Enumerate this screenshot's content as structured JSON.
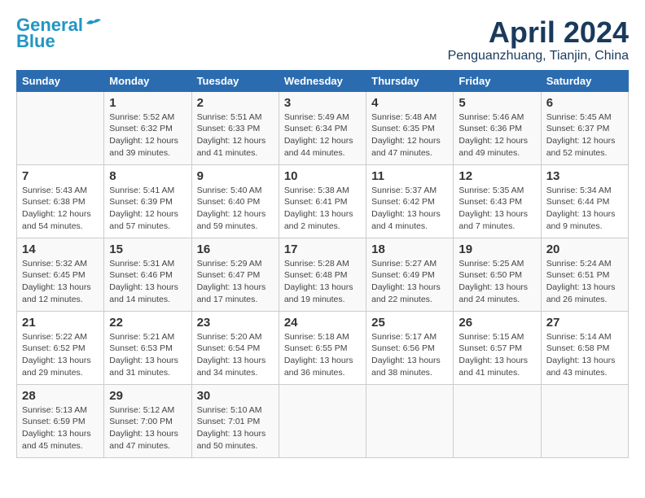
{
  "logo": {
    "line1": "General",
    "line2": "Blue"
  },
  "title": "April 2024",
  "subtitle": "Penguanzhuang, Tianjin, China",
  "weekdays": [
    "Sunday",
    "Monday",
    "Tuesday",
    "Wednesday",
    "Thursday",
    "Friday",
    "Saturday"
  ],
  "weeks": [
    [
      {
        "num": "",
        "info": ""
      },
      {
        "num": "1",
        "info": "Sunrise: 5:52 AM\nSunset: 6:32 PM\nDaylight: 12 hours\nand 39 minutes."
      },
      {
        "num": "2",
        "info": "Sunrise: 5:51 AM\nSunset: 6:33 PM\nDaylight: 12 hours\nand 41 minutes."
      },
      {
        "num": "3",
        "info": "Sunrise: 5:49 AM\nSunset: 6:34 PM\nDaylight: 12 hours\nand 44 minutes."
      },
      {
        "num": "4",
        "info": "Sunrise: 5:48 AM\nSunset: 6:35 PM\nDaylight: 12 hours\nand 47 minutes."
      },
      {
        "num": "5",
        "info": "Sunrise: 5:46 AM\nSunset: 6:36 PM\nDaylight: 12 hours\nand 49 minutes."
      },
      {
        "num": "6",
        "info": "Sunrise: 5:45 AM\nSunset: 6:37 PM\nDaylight: 12 hours\nand 52 minutes."
      }
    ],
    [
      {
        "num": "7",
        "info": "Sunrise: 5:43 AM\nSunset: 6:38 PM\nDaylight: 12 hours\nand 54 minutes."
      },
      {
        "num": "8",
        "info": "Sunrise: 5:41 AM\nSunset: 6:39 PM\nDaylight: 12 hours\nand 57 minutes."
      },
      {
        "num": "9",
        "info": "Sunrise: 5:40 AM\nSunset: 6:40 PM\nDaylight: 12 hours\nand 59 minutes."
      },
      {
        "num": "10",
        "info": "Sunrise: 5:38 AM\nSunset: 6:41 PM\nDaylight: 13 hours\nand 2 minutes."
      },
      {
        "num": "11",
        "info": "Sunrise: 5:37 AM\nSunset: 6:42 PM\nDaylight: 13 hours\nand 4 minutes."
      },
      {
        "num": "12",
        "info": "Sunrise: 5:35 AM\nSunset: 6:43 PM\nDaylight: 13 hours\nand 7 minutes."
      },
      {
        "num": "13",
        "info": "Sunrise: 5:34 AM\nSunset: 6:44 PM\nDaylight: 13 hours\nand 9 minutes."
      }
    ],
    [
      {
        "num": "14",
        "info": "Sunrise: 5:32 AM\nSunset: 6:45 PM\nDaylight: 13 hours\nand 12 minutes."
      },
      {
        "num": "15",
        "info": "Sunrise: 5:31 AM\nSunset: 6:46 PM\nDaylight: 13 hours\nand 14 minutes."
      },
      {
        "num": "16",
        "info": "Sunrise: 5:29 AM\nSunset: 6:47 PM\nDaylight: 13 hours\nand 17 minutes."
      },
      {
        "num": "17",
        "info": "Sunrise: 5:28 AM\nSunset: 6:48 PM\nDaylight: 13 hours\nand 19 minutes."
      },
      {
        "num": "18",
        "info": "Sunrise: 5:27 AM\nSunset: 6:49 PM\nDaylight: 13 hours\nand 22 minutes."
      },
      {
        "num": "19",
        "info": "Sunrise: 5:25 AM\nSunset: 6:50 PM\nDaylight: 13 hours\nand 24 minutes."
      },
      {
        "num": "20",
        "info": "Sunrise: 5:24 AM\nSunset: 6:51 PM\nDaylight: 13 hours\nand 26 minutes."
      }
    ],
    [
      {
        "num": "21",
        "info": "Sunrise: 5:22 AM\nSunset: 6:52 PM\nDaylight: 13 hours\nand 29 minutes."
      },
      {
        "num": "22",
        "info": "Sunrise: 5:21 AM\nSunset: 6:53 PM\nDaylight: 13 hours\nand 31 minutes."
      },
      {
        "num": "23",
        "info": "Sunrise: 5:20 AM\nSunset: 6:54 PM\nDaylight: 13 hours\nand 34 minutes."
      },
      {
        "num": "24",
        "info": "Sunrise: 5:18 AM\nSunset: 6:55 PM\nDaylight: 13 hours\nand 36 minutes."
      },
      {
        "num": "25",
        "info": "Sunrise: 5:17 AM\nSunset: 6:56 PM\nDaylight: 13 hours\nand 38 minutes."
      },
      {
        "num": "26",
        "info": "Sunrise: 5:15 AM\nSunset: 6:57 PM\nDaylight: 13 hours\nand 41 minutes."
      },
      {
        "num": "27",
        "info": "Sunrise: 5:14 AM\nSunset: 6:58 PM\nDaylight: 13 hours\nand 43 minutes."
      }
    ],
    [
      {
        "num": "28",
        "info": "Sunrise: 5:13 AM\nSunset: 6:59 PM\nDaylight: 13 hours\nand 45 minutes."
      },
      {
        "num": "29",
        "info": "Sunrise: 5:12 AM\nSunset: 7:00 PM\nDaylight: 13 hours\nand 47 minutes."
      },
      {
        "num": "30",
        "info": "Sunrise: 5:10 AM\nSunset: 7:01 PM\nDaylight: 13 hours\nand 50 minutes."
      },
      {
        "num": "",
        "info": ""
      },
      {
        "num": "",
        "info": ""
      },
      {
        "num": "",
        "info": ""
      },
      {
        "num": "",
        "info": ""
      }
    ]
  ]
}
